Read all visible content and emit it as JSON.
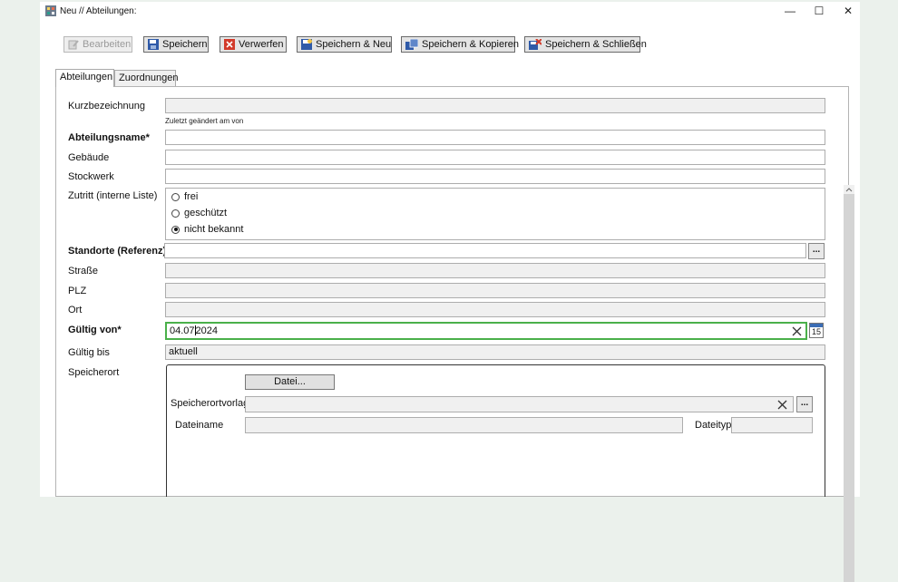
{
  "window": {
    "title": "Neu // Abteilungen:",
    "minimize_icon": "minimize-icon",
    "maximize_icon": "maximize-icon",
    "close_icon": "close-icon"
  },
  "toolbar": {
    "bearbeiten": "Bearbeiten",
    "speichern": "Speichern",
    "verwerfen": "Verwerfen",
    "speichern_neu": "Speichern & Neu",
    "speichern_kopieren": "Speichern & Kopieren",
    "speichern_schliessen": "Speichern & Schließen"
  },
  "tabs": [
    "Abteilungen",
    "Zuordnungen"
  ],
  "form": {
    "kurzbezeichnung": {
      "label": "Kurzbezeichnung",
      "value": ""
    },
    "last_changed": "Zuletzt geändert am  von",
    "abteilungsname": {
      "label": "Abteilungsname*",
      "value": ""
    },
    "gebaeude": {
      "label": "Gebäude",
      "value": ""
    },
    "stockwerk": {
      "label": "Stockwerk",
      "value": ""
    },
    "zutritt": {
      "label": "Zutritt (interne Liste)",
      "options": [
        "frei",
        "geschützt",
        "nicht bekannt"
      ],
      "selected": "nicht bekannt"
    },
    "standorte": {
      "label": "Standorte (Referenz)*",
      "value": "",
      "button": "..."
    },
    "strasse": {
      "label": "Straße",
      "value": ""
    },
    "plz": {
      "label": "PLZ",
      "value": ""
    },
    "ort": {
      "label": "Ort",
      "value": ""
    },
    "gueltig_von": {
      "label": "Gültig von*",
      "value_a": "04.07",
      "value_b": "2024",
      "calendar_day": "15"
    },
    "gueltig_bis": {
      "label": "Gültig bis",
      "value": "aktuell"
    },
    "speicherort": {
      "label": "Speicherort",
      "datei_button": "Datei...",
      "vorlage_label": "Speicherortvorlage",
      "vorlage_button": "...",
      "dateiname_label": "Dateiname",
      "dateityp_label": "Dateityp"
    }
  },
  "colors": {
    "focus": "#4ab04a",
    "readonly": "#f0f0f0"
  }
}
